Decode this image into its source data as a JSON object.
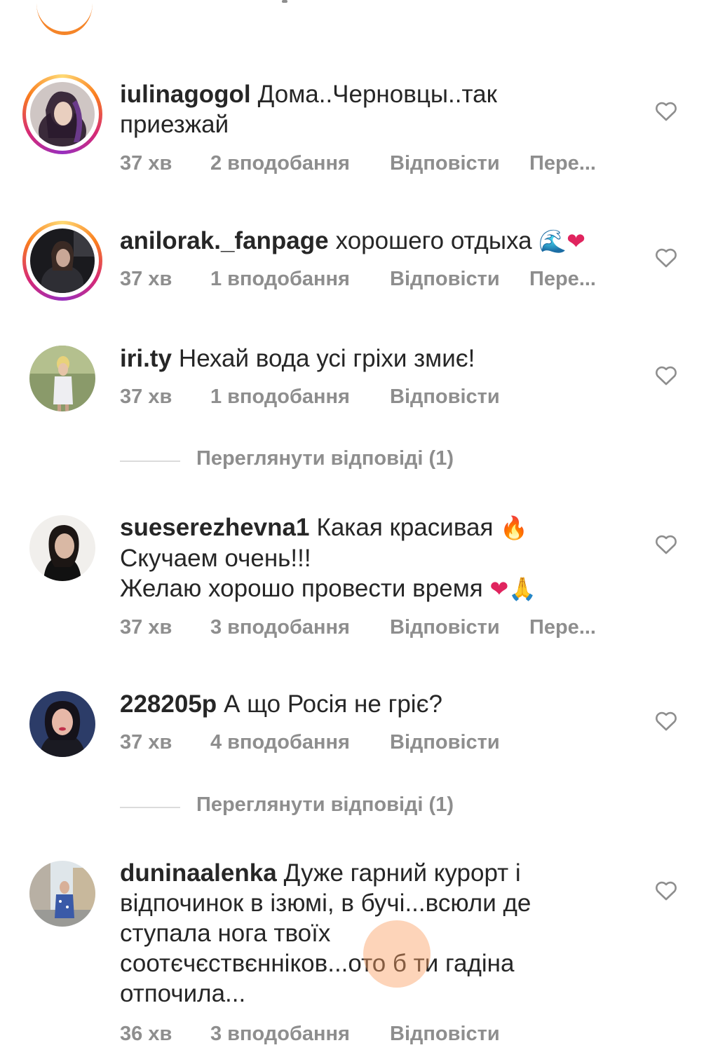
{
  "comments": [
    {
      "username": "iulinagogol",
      "text": "Дома..Черновцы..так приезжай",
      "time": "37 хв",
      "likes": "2 вподобання",
      "reply": "Відповісти",
      "more": "Пере..."
    },
    {
      "username": "anilorak._fanpage",
      "text": "хорошего отдыха",
      "emojis": [
        "🌊",
        "❤"
      ],
      "time": "37 хв",
      "likes": "1 вподобання",
      "reply": "Відповісти",
      "more": "Пере..."
    },
    {
      "username": "iri.ty",
      "text": "Нехай вода усі гріхи змиє!",
      "time": "37 хв",
      "likes": "1 вподобання",
      "reply": "Відповісти"
    },
    {
      "username": "sueserezhevna1",
      "line1": "Какая красивая",
      "line1_emoji": "🔥",
      "line2": "Скучаем очень!!!",
      "line3": "Желаю хорошо провести время",
      "line3_emojis": [
        "❤",
        "🙏"
      ],
      "time": "37 хв",
      "likes": "3 вподобання",
      "reply": "Відповісти",
      "more": "Пере..."
    },
    {
      "username": "228205p",
      "text": "А що Росія не гріє?",
      "time": "37 хв",
      "likes": "4 вподобання",
      "reply": "Відповісти"
    },
    {
      "username": "duninaalenka",
      "text": "Дуже гарний курорт і відпочинок в ізюмі, в бучі...всюли де ступала нога твоїх соотєчєствєнніков...ото б ти гадіна отпочила...",
      "time": "36 хв",
      "likes": "3 вподобання",
      "reply": "Відповісти"
    }
  ],
  "view_replies": [
    {
      "label": "Переглянути відповіді (1)"
    },
    {
      "label": "Переглянути відповіді (1)"
    }
  ],
  "icons": {
    "like": "heart-outline-icon"
  },
  "colors": {
    "text": "#262626",
    "secondary": "#8e8e8e",
    "divider": "#dbdbdb"
  }
}
